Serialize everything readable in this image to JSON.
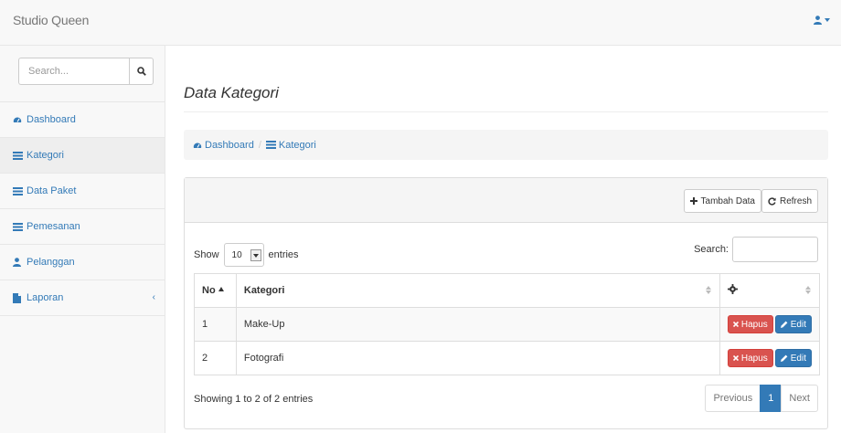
{
  "navbar": {
    "brand": "Studio Queen",
    "user_icon": "user-icon"
  },
  "sidebar": {
    "search_placeholder": "Search...",
    "items": [
      {
        "label": "Dashboard",
        "icon": "dashboard-icon"
      },
      {
        "label": "Kategori",
        "icon": "list-icon",
        "active": true
      },
      {
        "label": "Data Paket",
        "icon": "list-icon"
      },
      {
        "label": "Pemesanan",
        "icon": "list-icon"
      },
      {
        "label": "Pelanggan",
        "icon": "user-icon"
      },
      {
        "label": "Laporan",
        "icon": "file-icon",
        "chevron": "‹"
      }
    ]
  },
  "page": {
    "title": "Data Kategori",
    "breadcrumb": [
      "Dashboard",
      "Kategori"
    ]
  },
  "panel": {
    "add_label": "Tambah Data",
    "refresh_label": "Refresh"
  },
  "datatable": {
    "show_label": "Show",
    "length_value": "10",
    "entries_label": "entries",
    "search_label": "Search:",
    "columns": [
      "No",
      "Kategori"
    ],
    "rows": [
      {
        "no": "1",
        "kategori": "Make-Up"
      },
      {
        "no": "2",
        "kategori": "Fotografi"
      }
    ],
    "delete_label": "Hapus",
    "edit_label": "Edit",
    "info": "Showing 1 to 2 of 2 entries",
    "pagination": {
      "previous": "Previous",
      "page": "1",
      "next": "Next"
    }
  },
  "colors": {
    "accent": "#337ab7",
    "danger": "#d9534f"
  }
}
